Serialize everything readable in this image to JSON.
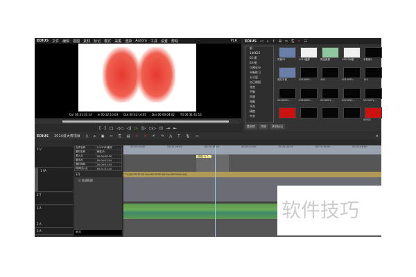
{
  "menubar": {
    "app": "EDIUS",
    "items": [
      "文件",
      "编辑",
      "视图",
      "素材",
      "标记",
      "模式",
      "采集",
      "渲染",
      "Aurora",
      "工具",
      "设置",
      "帮助"
    ],
    "mode": "PLR"
  },
  "player": {
    "timecodes": [
      "Cur 00:31:31:14",
      "In 00:32:10:03",
      "Out 00:32:14:05",
      "Dur 00:00:04:02",
      "Ttl 00:31:41:13"
    ]
  },
  "bin": {
    "title": "EDIUS",
    "folder": "根",
    "tree": [
      "根",
      "140625",
      "02-素",
      "03-图",
      "可视化分",
      "平衡练习",
      "分子层",
      "自己制图",
      "龙宫",
      "平衡",
      "资源",
      "电脑",
      "平台",
      "精度",
      "中文"
    ],
    "clips": [
      "背景25",
      "2014蓝屏",
      "简洁新建",
      "150726福",
      "手机版1",
      "测左手机",
      "2014090...",
      "100",
      "2014090...",
      "112",
      "2014090...",
      "2014090...",
      "2014091...",
      "2014091...",
      "2014091...",
      "",
      "",
      "",
      "",
      "00001"
    ],
    "tabs": [
      "素材库",
      "特效",
      "序列标记"
    ]
  },
  "timeline": {
    "project": "2014讲大寿项目",
    "ruler": [
      "00:31:30:00",
      "00:31:36:00",
      "00:31:38:00",
      "00:31:40:00",
      "00:31:42:00",
      "00:31:44:00",
      "00:31:46:00"
    ],
    "tracks": [
      "1 V",
      "1 VA",
      "2 T",
      "1 A",
      "2 A",
      "3 A"
    ],
    "clip_title": "杨俊(3) T...",
    "clip_bar": "T1 [00:00:31:24 Out:00:00:00:00 Dur:00:00:00:04]",
    "info_rows": [
      [
        "文件名称",
        "C:\\2013\\素材"
      ],
      [
        "素材名称",
        "杨俊(3)"
      ],
      [
        "源入点",
        "00:00:00:00"
      ],
      [
        "源出点",
        "00:00:01:04"
      ],
      [
        "源时间码",
        "00:00:01:04"
      ],
      [
        "时间线入点",
        "00:31:31:10"
      ]
    ],
    "info_layer": "1/1",
    "info_filter": "轨道贴图",
    "info_footer": "缩览"
  },
  "watermark": "软件技巧"
}
